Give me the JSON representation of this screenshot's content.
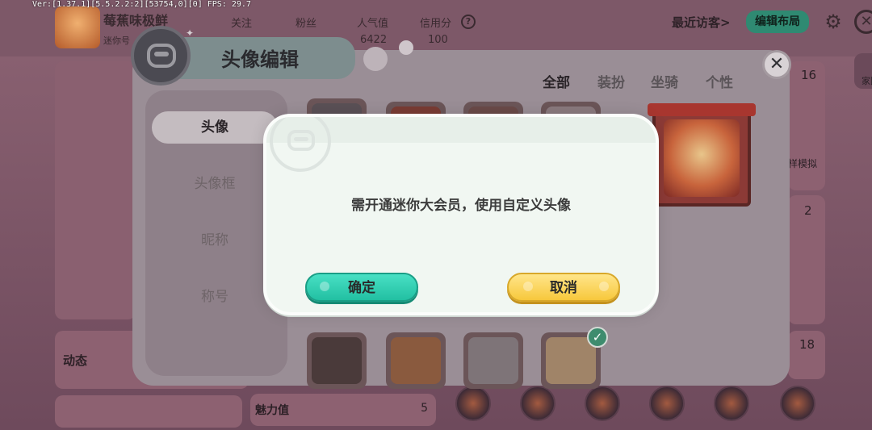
{
  "debug": {
    "fps_text": "Ver:[1.37.1][5.5.2.2:2][53754,0][0] FPS: 29.7"
  },
  "profile": {
    "name": "莓蕉味极鲜",
    "subname": "迷你号",
    "stats": [
      {
        "label": "关注",
        "value": ""
      },
      {
        "label": "粉丝",
        "value": ""
      },
      {
        "label": "人气值",
        "value": "6422"
      },
      {
        "label": "信用分",
        "value": "100"
      }
    ],
    "help_glyph": "?",
    "recent_visitors": "最近访客>",
    "edit_layout": "编辑布局",
    "home_label": "家园",
    "dynamic_label": "动态",
    "charm_label": "魅力值",
    "charm_value": "5",
    "right_counts": [
      "16",
      "2",
      "18"
    ],
    "right_card_text": "样模拟"
  },
  "avatar_editor": {
    "title": "头像编辑",
    "tabs": [
      "全部",
      "装扮",
      "坐骑",
      "个性"
    ],
    "active_tab": "全部",
    "side_menu": [
      "头像",
      "头像框",
      "昵称",
      "称号"
    ],
    "active_side": "头像",
    "selected_check": "✓"
  },
  "dialog": {
    "message": "需开通迷你大会员，使用自定义头像",
    "confirm_label": "确定",
    "cancel_label": "取消"
  },
  "icons": {
    "close": "✕",
    "gear": "⚙"
  },
  "colors": {
    "confirm_button": "#2fd0b2",
    "cancel_button": "#fcd452",
    "dialog_bg": "#f1f7f2"
  }
}
